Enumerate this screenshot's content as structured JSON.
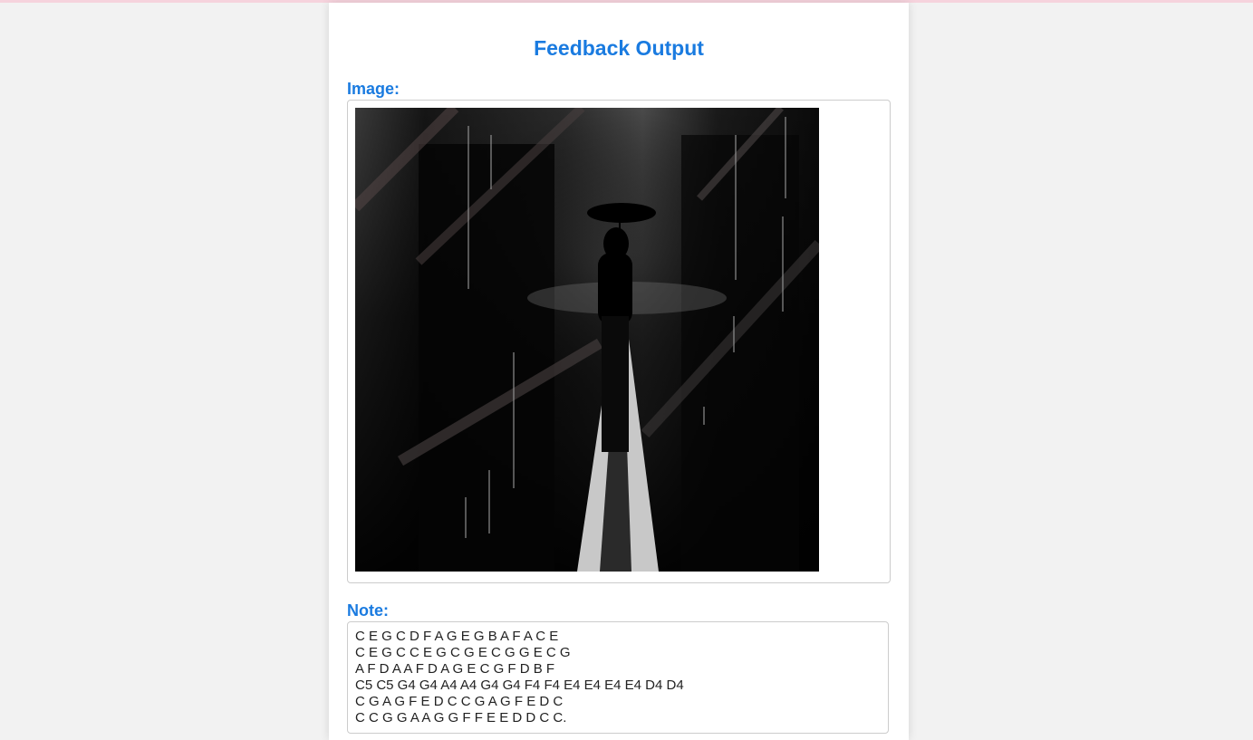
{
  "page": {
    "title": "Feedback Output"
  },
  "image_section": {
    "label": "Image:",
    "image_subject": "silhouette-with-umbrella-in-rain"
  },
  "note_section": {
    "label": "Note:",
    "lines": [
      "C E G C D F A G E G B A F A C E",
      "C E G C C E G C G E C G G E C G",
      "A F D A A F D A G E C G F D B F",
      "C5 C5 G4 G4 A4 A4 G4 G4 F4 F4 E4 E4 E4 E4 D4 D4",
      "C G A G F E D C C G A G F E D C",
      "C C G G A A G G F F E E D D C C."
    ]
  },
  "colors": {
    "accent": "#1a7be0",
    "background": "#f2f2f2",
    "panel": "#ffffff",
    "border": "#cccccc"
  }
}
